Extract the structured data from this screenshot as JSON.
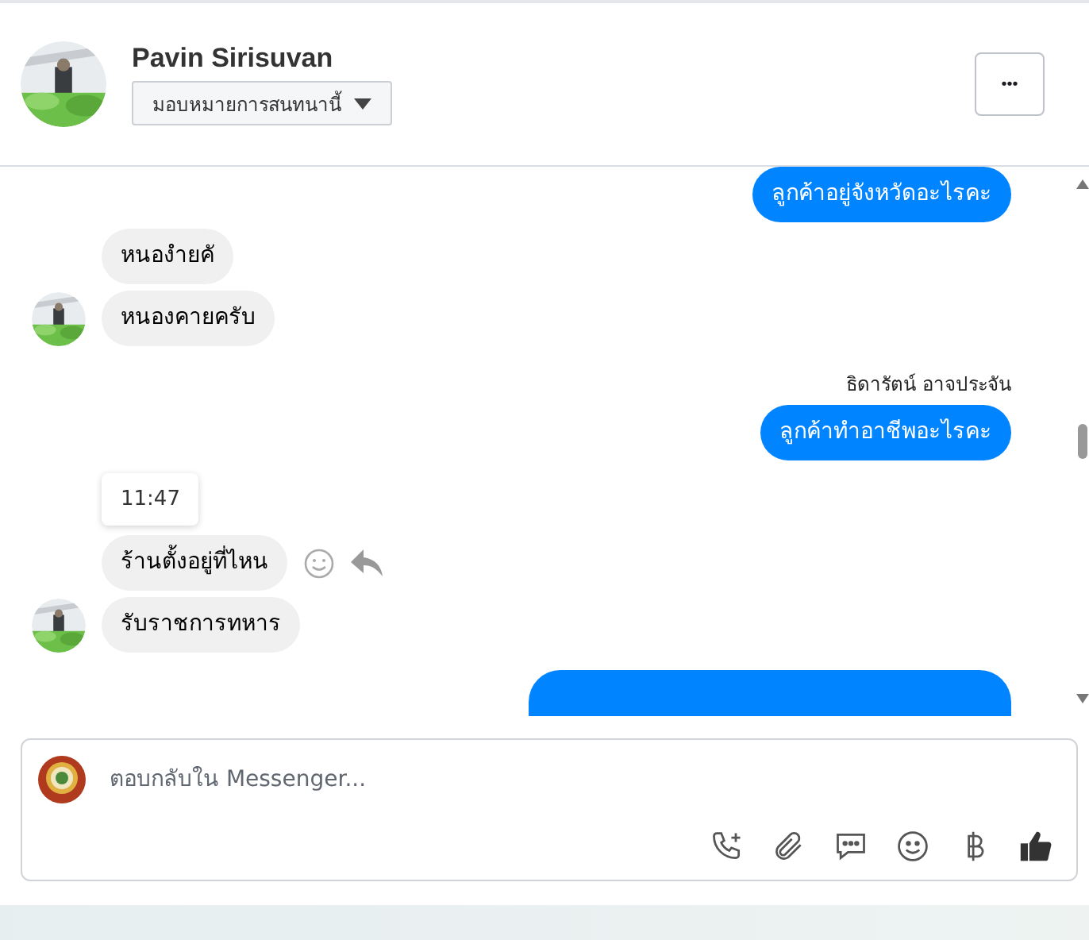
{
  "header": {
    "name": "Pavin Sirisuvan",
    "assign_label": "มอบหมายการสนทนานี้",
    "more_label": "•••"
  },
  "messages": [
    {
      "kind": "sent",
      "text": "ลูกค้าอยู่จังหวัดอะไรคะ"
    },
    {
      "kind": "received",
      "text": "หนองํายคั",
      "avatar": false,
      "hovered": false
    },
    {
      "kind": "received",
      "text": "หนองคายครับ",
      "avatar": true,
      "hovered": false
    },
    {
      "kind": "sender",
      "text": "ธิดารัตน์ อาจประจัน"
    },
    {
      "kind": "sent",
      "text": "ลูกค้าทำอาชีพอะไรคะ"
    },
    {
      "kind": "time",
      "text": "11:47"
    },
    {
      "kind": "received",
      "text": "ร้านตั้งอยู่ที่ไหน",
      "avatar": false,
      "hovered": true
    },
    {
      "kind": "received",
      "text": "รับราชการทหาร",
      "avatar": true,
      "hovered": false
    },
    {
      "kind": "sent_cut"
    }
  ],
  "composer": {
    "placeholder": "ตอบกลับใน Messenger..."
  }
}
